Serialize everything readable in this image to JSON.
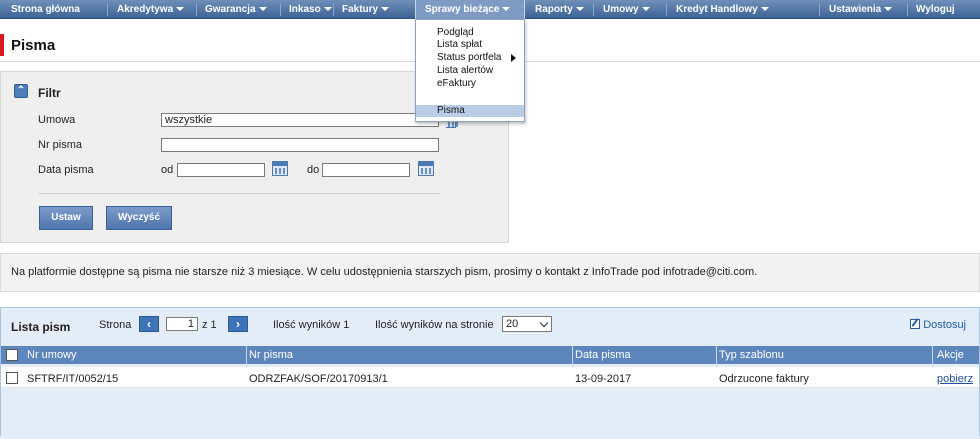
{
  "nav": {
    "items": [
      {
        "label": "Strona główna",
        "caret": false
      },
      {
        "label": "Akredytywa",
        "caret": true
      },
      {
        "label": "Gwarancja",
        "caret": true
      },
      {
        "label": "Inkaso",
        "caret": true
      },
      {
        "label": "Faktury",
        "caret": true
      },
      {
        "label": "Sprawy bieżące",
        "caret": true,
        "active": true
      },
      {
        "label": "Raporty",
        "caret": true
      },
      {
        "label": "Umowy",
        "caret": true
      },
      {
        "label": "Kredyt Handlowy",
        "caret": true
      },
      {
        "label": "Ustawienia",
        "caret": true
      },
      {
        "label": "Wyloguj",
        "caret": false
      }
    ]
  },
  "dropdown": {
    "items": [
      {
        "label": "Podgląd"
      },
      {
        "label": "Lista spłat"
      },
      {
        "label": "Status portfela",
        "submenu": true
      },
      {
        "label": "Lista alertów"
      },
      {
        "label": "eFaktury"
      },
      {
        "label": "Pisma",
        "highlighted": true
      }
    ]
  },
  "page": {
    "title": "Pisma"
  },
  "filter": {
    "title": "Filtr",
    "umowa_label": "Umowa",
    "umowa_value": "wszystkie",
    "nr_pisma_label": "Nr pisma",
    "nr_pisma_value": "",
    "data_pisma_label": "Data pisma",
    "od_label": "od",
    "do_label": "do",
    "od_value": "",
    "do_value": "",
    "set_button": "Ustaw",
    "clear_button": "Wyczyść"
  },
  "info": {
    "text": "Na platformie dostępne są pisma nie starsze niż 3 miesiące. W celu udostępnienia starszych pism, prosimy o kontakt z InfoTrade pod infotrade@citi.com."
  },
  "list": {
    "title": "Lista pism",
    "page_label": "Strona",
    "page_value": "1",
    "page_of": "z 1",
    "results_count": "Ilość wyników 1",
    "per_page_label": "Ilość wyników na stronie",
    "per_page_value": "20",
    "customize": "Dostosuj",
    "columns": [
      "Nr umowy",
      "Nr pisma",
      "Data pisma",
      "Typ szablonu",
      "Akcje"
    ],
    "rows": [
      {
        "nr_umowy": "SFTRF/IT/0052/15",
        "nr_pisma": "ODRZFAK/SOF/20170913/1",
        "data_pisma": "13-09-2017",
        "typ_szablonu": "Odrzucone faktury",
        "akcje": "pobierz"
      }
    ]
  },
  "colors": {
    "nav": "#3d6497",
    "accent_red": "#d71920",
    "table_header": "#5d86bd",
    "list_bg": "#e3edf8"
  }
}
